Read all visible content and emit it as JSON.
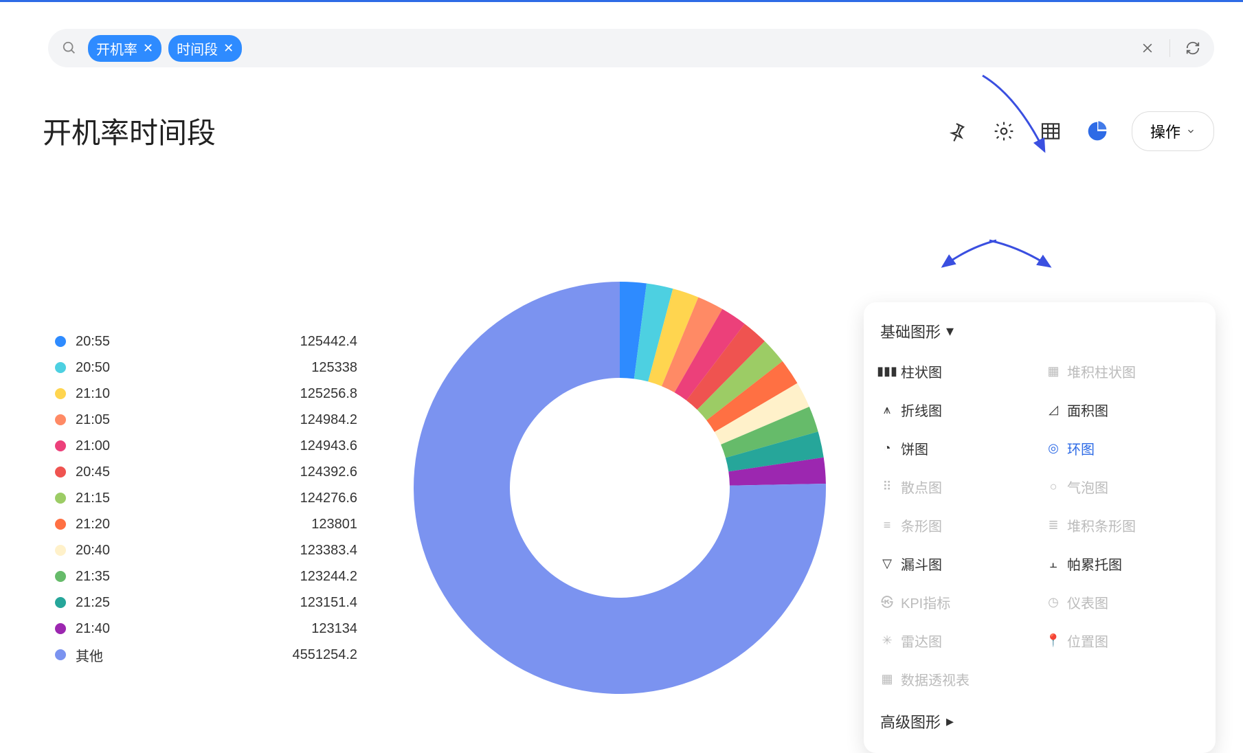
{
  "search": {
    "chips": [
      "开机率",
      "时间段"
    ]
  },
  "page_title": "开机率时间段",
  "action_label": "操作",
  "panel": {
    "basic_header": "基础图形",
    "advanced_header": "高级图形",
    "options": [
      {
        "label": "柱状图",
        "enabled": true
      },
      {
        "label": "堆积柱状图",
        "enabled": false
      },
      {
        "label": "折线图",
        "enabled": true
      },
      {
        "label": "面积图",
        "enabled": true
      },
      {
        "label": "饼图",
        "enabled": true
      },
      {
        "label": "环图",
        "enabled": true,
        "selected": true
      },
      {
        "label": "散点图",
        "enabled": false
      },
      {
        "label": "气泡图",
        "enabled": false
      },
      {
        "label": "条形图",
        "enabled": false
      },
      {
        "label": "堆积条形图",
        "enabled": false
      },
      {
        "label": "漏斗图",
        "enabled": true
      },
      {
        "label": "帕累托图",
        "enabled": true
      },
      {
        "label": "KPI指标",
        "enabled": false
      },
      {
        "label": "仪表图",
        "enabled": false
      },
      {
        "label": "雷达图",
        "enabled": false
      },
      {
        "label": "位置图",
        "enabled": false
      },
      {
        "label": "数据透视表",
        "enabled": false
      }
    ]
  },
  "chart_data": {
    "type": "pie",
    "title": "开机率时间段",
    "series": [
      {
        "name": "20:55",
        "value": 125442.4,
        "color": "#2e8bff"
      },
      {
        "name": "20:50",
        "value": 125338,
        "color": "#4dd0e1"
      },
      {
        "name": "21:10",
        "value": 125256.8,
        "color": "#ffd54f"
      },
      {
        "name": "21:05",
        "value": 124984.2,
        "color": "#ff8a65"
      },
      {
        "name": "21:00",
        "value": 124943.6,
        "color": "#ec407a"
      },
      {
        "name": "20:45",
        "value": 124392.6,
        "color": "#ef5350"
      },
      {
        "name": "21:15",
        "value": 124276.6,
        "color": "#9ccc65"
      },
      {
        "name": "21:20",
        "value": 123801,
        "color": "#ff7043"
      },
      {
        "name": "20:40",
        "value": 123383.4,
        "color": "#fff1ca"
      },
      {
        "name": "21:35",
        "value": 123244.2,
        "color": "#66bb6a"
      },
      {
        "name": "21:25",
        "value": 123151.4,
        "color": "#26a69a"
      },
      {
        "name": "21:40",
        "value": 123134,
        "color": "#9c27b0"
      },
      {
        "name": "其他",
        "value": 4551254.2,
        "color": "#7b93f0"
      }
    ]
  }
}
